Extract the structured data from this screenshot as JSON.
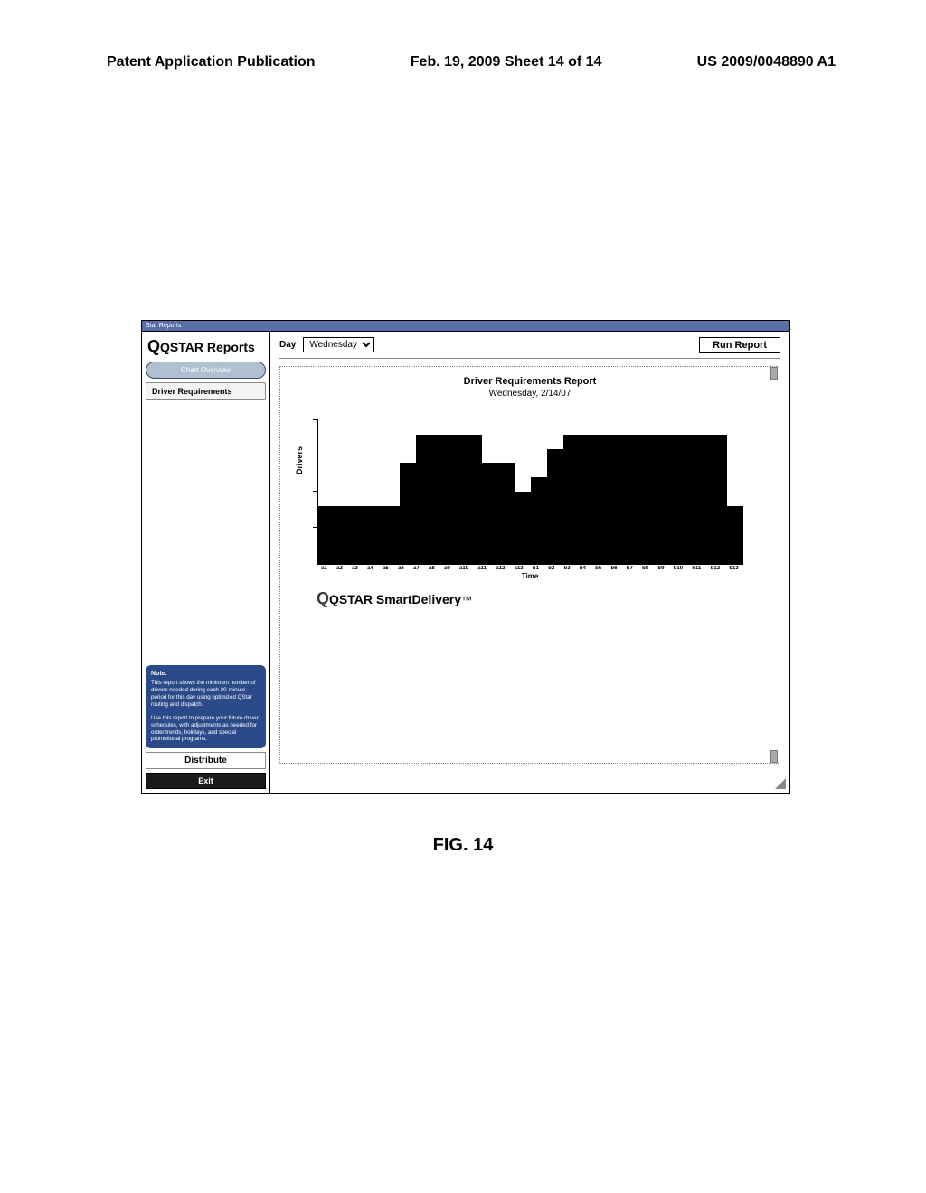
{
  "page_header": {
    "left": "Patent Application Publication",
    "center": "Feb. 19, 2009  Sheet 14 of 14",
    "right": "US 2009/0048890 A1"
  },
  "figure_caption": "FIG. 14",
  "window": {
    "titlebar": "Star Reports"
  },
  "sidebar": {
    "brand": "QSTAR Reports",
    "tab_button": "Chart Overview",
    "selected_item": "Driver Requirements",
    "note_heading": "Note:",
    "note_p1": "This report shows the minimum number of drivers needed during each 30-minute period for this day using optimized QStar routing and dispatch.",
    "note_p2": "Use this report to prepare your future driver schedules, with adjustments as needed for order trends, holidays, and special promotional programs.",
    "distribute_label": "Distribute",
    "exit_label": "Exit"
  },
  "toolbar": {
    "day_label": "Day",
    "day_value": "Wednesday",
    "run_label": "Run Report"
  },
  "report": {
    "title": "Driver Requirements Report",
    "subtitle": "Wednesday, 2/14/07",
    "brand_line": "QSTAR SmartDelivery"
  },
  "chart_data": {
    "type": "bar",
    "title": "Driver Requirements Report",
    "subtitle": "Wednesday, 2/14/07",
    "xlabel": "Time",
    "ylabel": "Drivers",
    "ylim": [
      0,
      10
    ],
    "categories": [
      "a1",
      "a2",
      "a3",
      "a4",
      "a5",
      "a6",
      "a7",
      "a8",
      "a9",
      "a10",
      "a11",
      "a12",
      "a13",
      "b1",
      "b2",
      "b3",
      "b4",
      "b5",
      "b6",
      "b7",
      "b8",
      "b9",
      "b10",
      "b11",
      "b12",
      "b13"
    ],
    "values": [
      4,
      4,
      4,
      4,
      4,
      7,
      9,
      9,
      9,
      9,
      7,
      7,
      5,
      6,
      8,
      9,
      9,
      9,
      9,
      9,
      9,
      9,
      9,
      9,
      9,
      4
    ]
  }
}
